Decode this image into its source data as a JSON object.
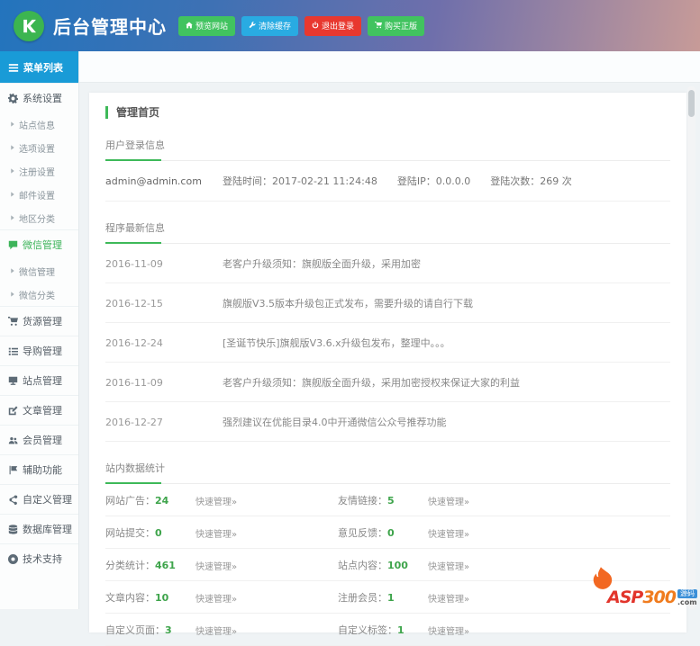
{
  "colors": {
    "accent_green": "#3eb959",
    "sidebar_header_blue": "#199bd7",
    "button_blue": "#29abe2",
    "button_red": "#e8382f",
    "header_gradient_left": "#2374bd",
    "header_gradient_mid": "#6f6fab",
    "header_gradient_right": "#c79b98"
  },
  "header": {
    "title": "后台管理中心",
    "buttons": [
      {
        "name": "preview-site-button",
        "label": "预览网站",
        "icon": "home",
        "style": "green"
      },
      {
        "name": "clear-cache-button",
        "label": "清除缓存",
        "icon": "wrench",
        "style": "blue"
      },
      {
        "name": "logout-button",
        "label": "退出登录",
        "icon": "power",
        "style": "red"
      },
      {
        "name": "buy-genuine-button",
        "label": "购买正版",
        "icon": "cart",
        "style": "green"
      }
    ]
  },
  "sidebar": {
    "header": {
      "label": "菜单列表",
      "icon": "menu"
    },
    "items": [
      {
        "name": "menu-system-settings",
        "type": "main",
        "icon": "gear",
        "label": "系统设置"
      },
      {
        "name": "submenu-site-info",
        "type": "sub",
        "label": "站点信息"
      },
      {
        "name": "submenu-option-settings",
        "type": "sub",
        "label": "选项设置"
      },
      {
        "name": "submenu-register-settings",
        "type": "sub",
        "label": "注册设置"
      },
      {
        "name": "submenu-mail-settings",
        "type": "sub",
        "label": "邮件设置"
      },
      {
        "name": "submenu-region-category",
        "type": "sub",
        "label": "地区分类"
      },
      {
        "name": "menu-wechat-management",
        "type": "main",
        "icon": "comment",
        "label": "微信管理",
        "active": true
      },
      {
        "name": "submenu-wechat-management",
        "type": "sub",
        "label": "微信管理"
      },
      {
        "name": "submenu-wechat-category",
        "type": "sub",
        "label": "微信分类"
      },
      {
        "name": "menu-supply-management",
        "type": "main",
        "icon": "cart",
        "label": "货源管理"
      },
      {
        "name": "menu-guide-management",
        "type": "main",
        "icon": "list",
        "label": "导购管理"
      },
      {
        "name": "menu-site-management",
        "type": "main",
        "icon": "desktop",
        "label": "站点管理"
      },
      {
        "name": "menu-article-management",
        "type": "main",
        "icon": "edit",
        "label": "文章管理"
      },
      {
        "name": "menu-member-management",
        "type": "main",
        "icon": "users",
        "label": "会员管理"
      },
      {
        "name": "menu-auxiliary-functions",
        "type": "main",
        "icon": "flag",
        "label": "辅助功能"
      },
      {
        "name": "menu-custom-management",
        "type": "main",
        "icon": "share",
        "label": "自定义管理"
      },
      {
        "name": "menu-database-management",
        "type": "main",
        "icon": "database",
        "label": "数据库管理"
      },
      {
        "name": "menu-tech-support",
        "type": "main",
        "icon": "support",
        "label": "技术支持"
      }
    ]
  },
  "main": {
    "page_title": "管理首页",
    "login": {
      "title": "用户登录信息",
      "email": "admin@admin.com",
      "fields": [
        "登陆时间：2017-02-21 11:24:48",
        "登陆IP：0.0.0.0",
        "登陆次数：269 次"
      ]
    },
    "news": {
      "title": "程序最新信息",
      "rows": [
        {
          "date": "2016-11-09",
          "text": "老客户升级须知：旗舰版全面升级，采用加密"
        },
        {
          "date": "2016-12-15",
          "text": "旗舰版V3.5版本升级包正式发布，需要升级的请自行下载"
        },
        {
          "date": "2016-12-24",
          "text": "[圣诞节快乐]旗舰版V3.6.x升级包发布，整理中。。。"
        },
        {
          "date": "2016-11-09",
          "text": "老客户升级须知：旗舰版全面升级，采用加密授权来保证大家的利益"
        },
        {
          "date": "2016-12-27",
          "text": "强烈建议在优能目录4.0中开通微信公众号推荐功能"
        }
      ]
    },
    "stats": {
      "title": "站内数据统计",
      "link_label": "快速管理»",
      "rows": [
        {
          "left": {
            "label": "网站广告",
            "value": "24"
          },
          "right": {
            "label": "友情链接",
            "value": "5"
          }
        },
        {
          "left": {
            "label": "网站提交",
            "value": "0"
          },
          "right": {
            "label": "意见反馈",
            "value": "0"
          }
        },
        {
          "left": {
            "label": "分类统计",
            "value": "461"
          },
          "right": {
            "label": "站点内容",
            "value": "100"
          }
        },
        {
          "left": {
            "label": "文章内容",
            "value": "10"
          },
          "right": {
            "label": "注册会员",
            "value": "1"
          }
        },
        {
          "left": {
            "label": "自定义页面",
            "value": "3"
          },
          "right": {
            "label": "自定义标签",
            "value": "1"
          }
        }
      ]
    }
  },
  "watermark": {
    "brand_a": "ASP",
    "brand_b": "300",
    "tag": "源码",
    "domain": ".com"
  }
}
